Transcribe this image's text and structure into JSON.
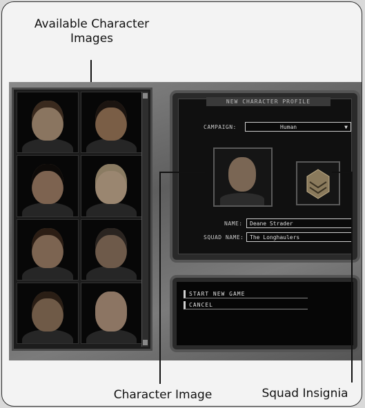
{
  "callouts": {
    "available_images": "Available Character Images",
    "character_image": "Character Image",
    "squad_insignia": "Squad Insignia"
  },
  "profile": {
    "title": "NEW CHARACTER PROFILE",
    "campaign_label": "CAMPAIGN:",
    "campaign_value": "Human",
    "name_label": "NAME:",
    "name_value": "Deane Strader",
    "squad_name_label": "SQUAD NAME:",
    "squad_name_value": "The Longhaulers"
  },
  "actions": {
    "start_new_game": "START NEW GAME",
    "cancel": "CANCEL"
  },
  "gallery": {
    "portraits": [
      {
        "icon": "portrait-sunglasses-icon",
        "skin": "#8a7560",
        "hair": "#3a2a1e"
      },
      {
        "icon": "portrait-young-man-icon",
        "skin": "#7a5e46",
        "hair": "#1b1410"
      },
      {
        "icon": "portrait-woman-dark-hair-icon",
        "skin": "#7d6350",
        "hair": "#0d0a08"
      },
      {
        "icon": "portrait-woman-blonde-icon",
        "skin": "#9a8670",
        "hair": "#8a7b62"
      },
      {
        "icon": "portrait-bearded-man-icon",
        "skin": "#7c6451",
        "hair": "#2b1d14"
      },
      {
        "icon": "portrait-woman-curly-icon",
        "skin": "#6e5a4a",
        "hair": "#2a2420"
      },
      {
        "icon": "portrait-goatee-man-icon",
        "skin": "#6f5a47",
        "hair": "#2a1e15"
      },
      {
        "icon": "portrait-bald-man-icon",
        "skin": "#8c7563",
        "hair": "#8c7563"
      }
    ]
  }
}
